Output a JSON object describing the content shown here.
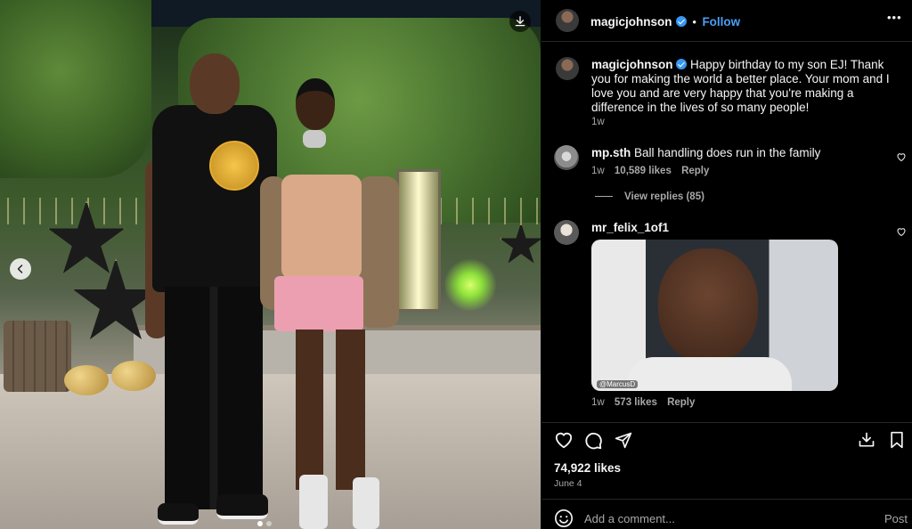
{
  "post": {
    "author": "magicjohnson",
    "follow_label": "Follow",
    "more_label": "•••",
    "caption_author": "magicjohnson",
    "caption": "Happy birthday to my son EJ! Thank you for making the world a better place. Your mom and I love you and are very happy that you're making a difference in the lives of so many people!",
    "caption_time": "1w",
    "likes": "74,922 likes",
    "date": "June 4"
  },
  "comments": [
    {
      "author": "mp.sth",
      "text": "Ball handling does run in the family",
      "time": "1w",
      "likes": "10,589 likes",
      "reply_label": "Reply",
      "view_replies": "View replies (85)"
    },
    {
      "author": "mr_felix_1of1",
      "gif_watermark": "@MarcusD",
      "time": "1w",
      "likes": "573 likes",
      "reply_label": "Reply"
    }
  ],
  "composer": {
    "placeholder": "Add a comment...",
    "post_label": "Post"
  },
  "carousel": {
    "total": 2,
    "current": 1
  },
  "colors": {
    "accent": "#4a9ff5",
    "verified": "#3897f0",
    "background": "#000000",
    "muted": "#a8a8a8"
  },
  "icons": [
    "download-icon",
    "chevron-left-icon",
    "verified-badge-icon",
    "more-icon",
    "heart-icon",
    "comment-icon",
    "share-icon",
    "save-icon",
    "bookmark-icon",
    "emoji-icon"
  ]
}
